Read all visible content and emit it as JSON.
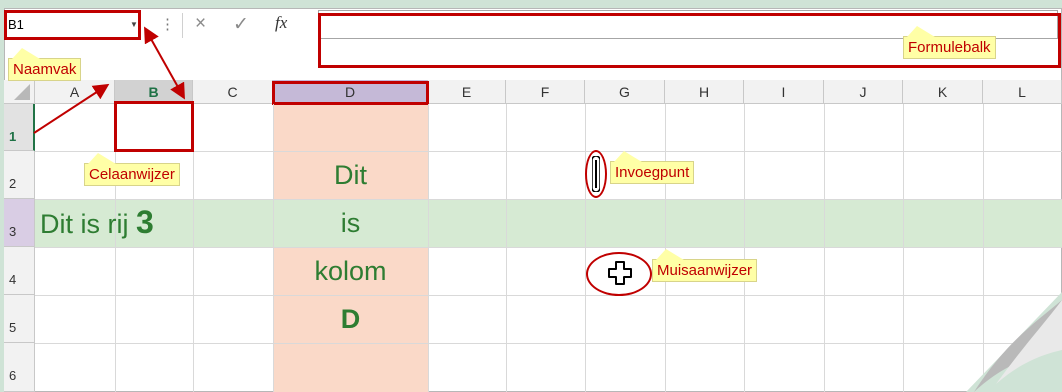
{
  "name_box": {
    "value": "B1"
  },
  "formula_bar": {
    "cancel_icon": "×",
    "enter_icon": "✓",
    "function_icon": "fx",
    "dots_icon": "⋮",
    "value": ""
  },
  "columns": [
    "A",
    "B",
    "C",
    "D",
    "E",
    "F",
    "G",
    "H",
    "I",
    "J",
    "K",
    "L"
  ],
  "rows": [
    "1",
    "2",
    "3",
    "4",
    "5",
    "6"
  ],
  "cells": {
    "A3": "Dit is rij",
    "A3_number": "3",
    "D2": "Dit",
    "D3": "is",
    "D4": "kolom",
    "D5": "D"
  },
  "annotations": {
    "namevak": "Naamvak",
    "formulebalk": "Formulebalk",
    "celaanwijzer": "Celaanwijzer",
    "invoegpunt": "Invoegpunt",
    "muisaanwijzer": "Muisaanwijzer"
  },
  "colors": {
    "highlight_red": "#c00000",
    "row3_fill": "#d6ead3",
    "colD_fill": "#fad9c8",
    "cell_text_green": "#2e7d32",
    "note_yellow": "#ffffa6"
  }
}
